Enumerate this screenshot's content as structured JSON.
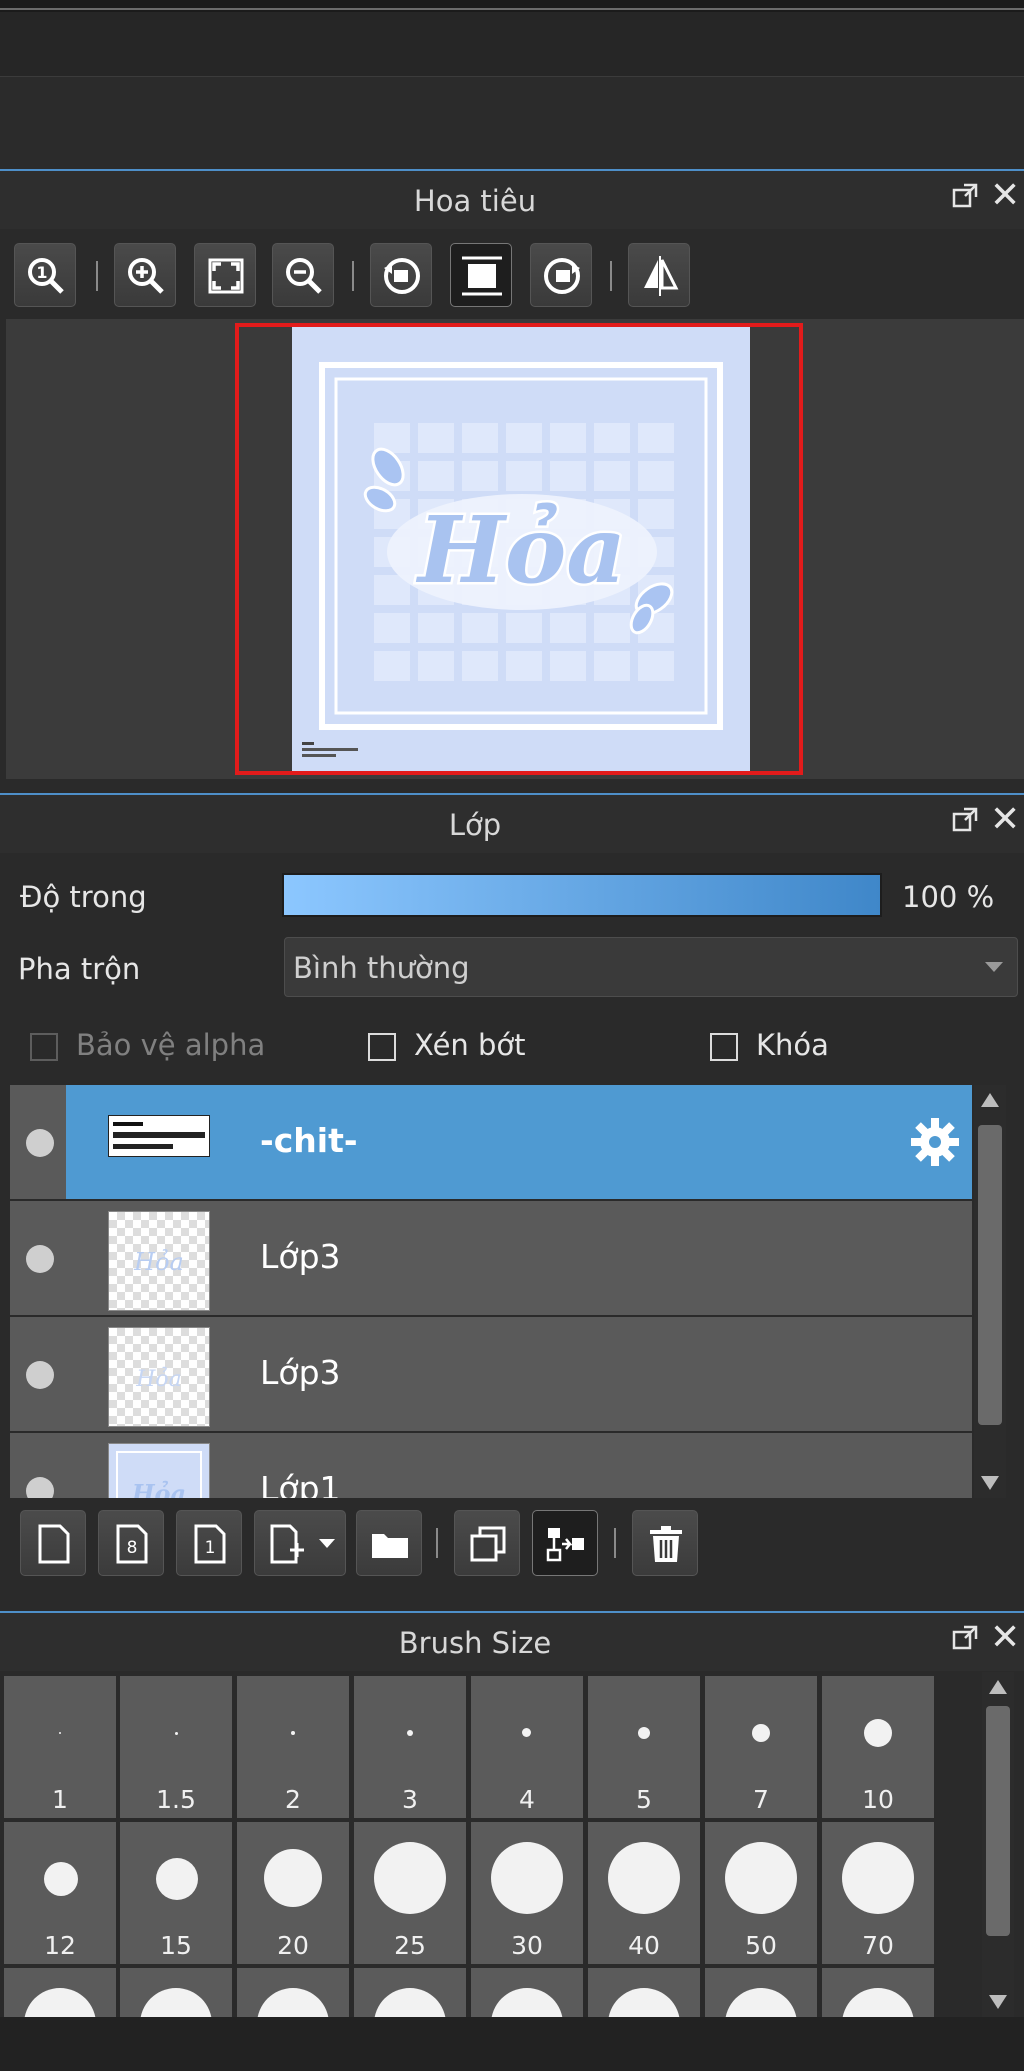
{
  "navigator": {
    "title": "Hoa tiêu",
    "toolbar": [
      "zoom-actual-icon",
      "zoom-in-icon",
      "fit-screen-icon",
      "zoom-out-icon",
      "rotate-left-icon",
      "fit-view-icon",
      "rotate-right-icon",
      "flip-horizontal-icon"
    ],
    "preview_text": "Hỏa"
  },
  "layers": {
    "title": "Lớp",
    "opacity_label": "Độ trong",
    "opacity_value": "100 %",
    "opacity_fraction": 1.0,
    "blend_label": "Pha trộn",
    "blend_value": "Bình thường",
    "protect_alpha": "Bảo vệ alpha",
    "clipping": "Xén bớt",
    "lock": "Khóa",
    "items": [
      {
        "name": "-chit-",
        "selected": true
      },
      {
        "name": "Lớp3",
        "selected": false
      },
      {
        "name": "Lớp3",
        "selected": false
      },
      {
        "name": "Lớp1",
        "selected": false
      }
    ]
  },
  "brush_size": {
    "title": "Brush Size",
    "sizes": [
      "1",
      "1.5",
      "2",
      "3",
      "4",
      "5",
      "7",
      "10",
      "12",
      "15",
      "20",
      "25",
      "30",
      "40",
      "50",
      "70"
    ]
  },
  "colors": {
    "accent": "#4f9ad2",
    "panel_bg": "#2a2a2a",
    "selection_frame": "#e21b1b"
  }
}
